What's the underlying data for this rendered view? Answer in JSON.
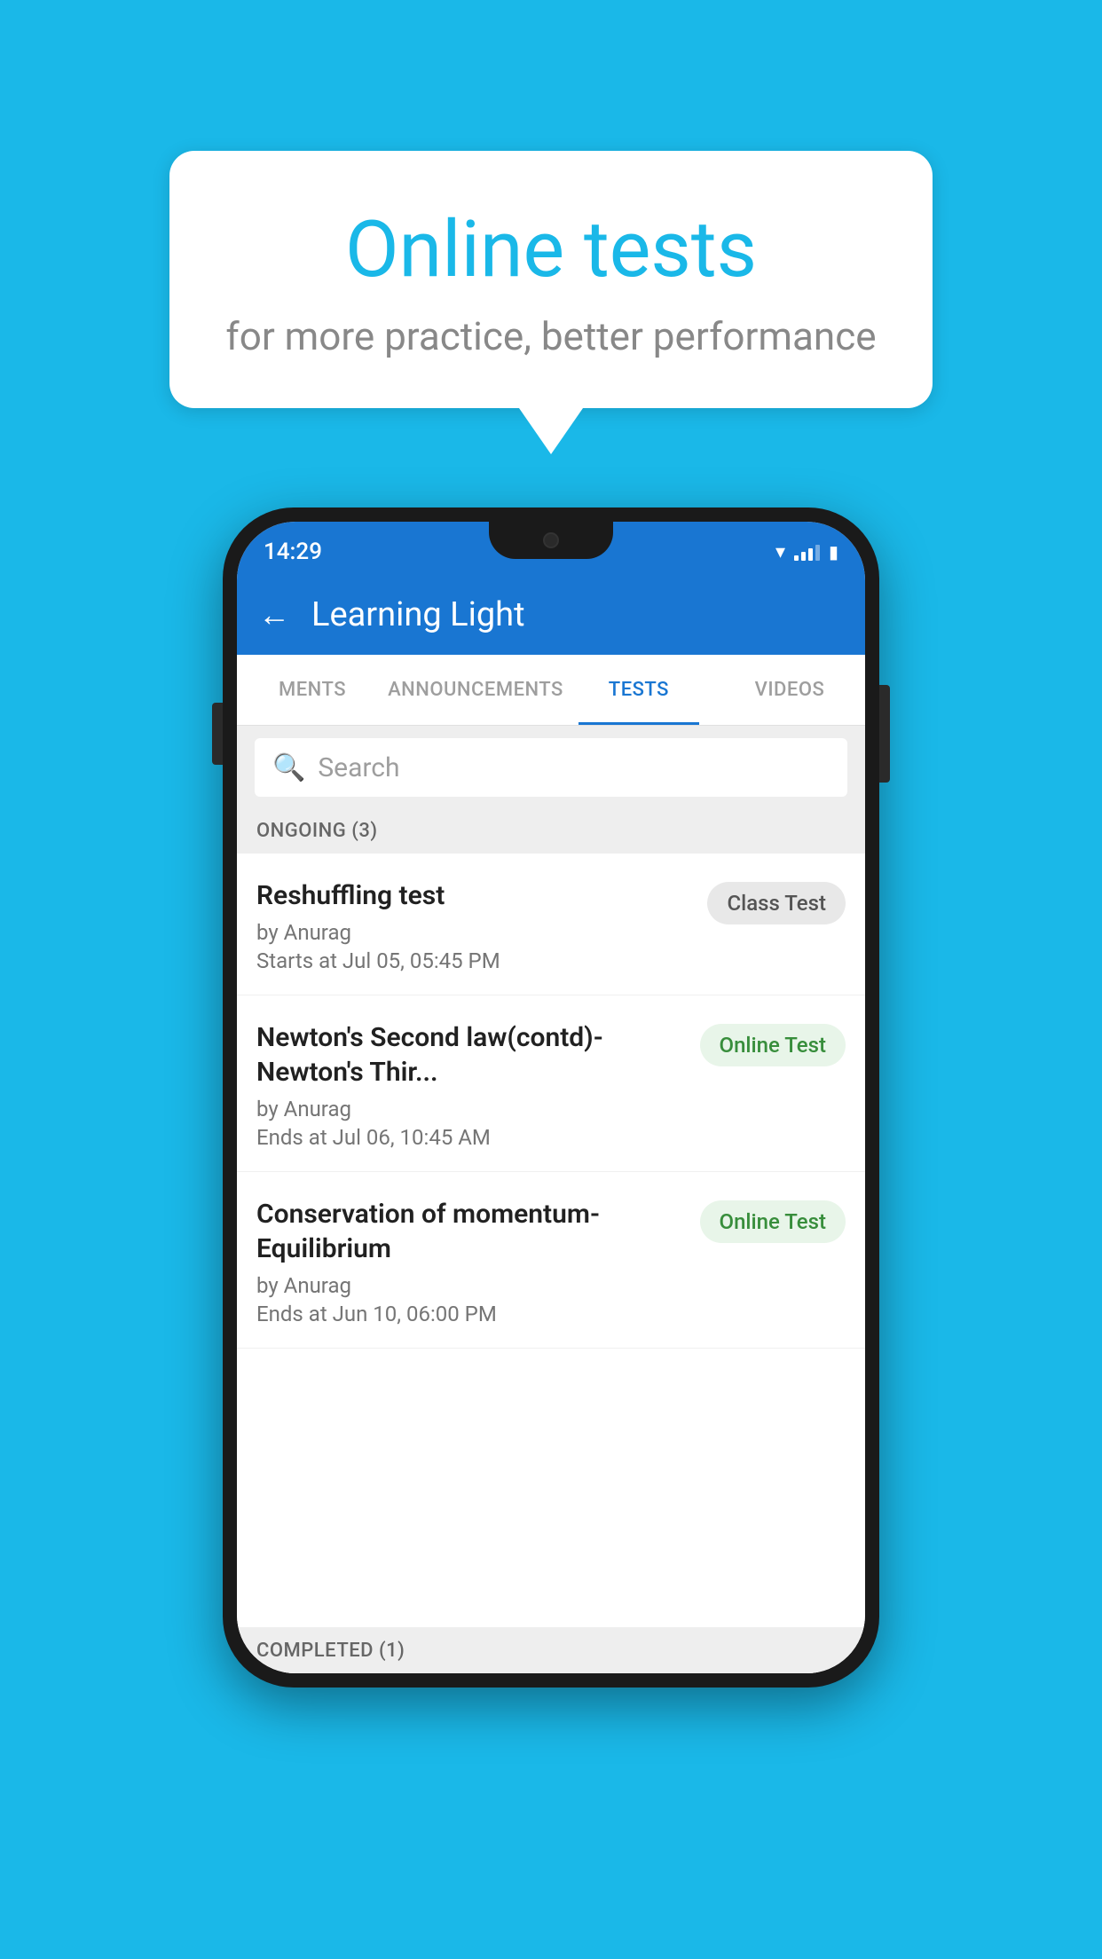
{
  "background_color": "#1ab8e8",
  "speech_bubble": {
    "title": "Online tests",
    "subtitle": "for more practice, better performance"
  },
  "phone": {
    "status_bar": {
      "time": "14:29"
    },
    "header": {
      "title": "Learning Light",
      "back_label": "←"
    },
    "tabs": [
      {
        "label": "MENTS",
        "active": false
      },
      {
        "label": "ANNOUNCEMENTS",
        "active": false
      },
      {
        "label": "TESTS",
        "active": true
      },
      {
        "label": "VIDEOS",
        "active": false
      }
    ],
    "search": {
      "placeholder": "Search"
    },
    "ongoing_section": {
      "label": "ONGOING (3)"
    },
    "tests": [
      {
        "name": "Reshuffling test",
        "author": "by Anurag",
        "date": "Starts at  Jul 05, 05:45 PM",
        "badge": "Class Test",
        "badge_type": "class"
      },
      {
        "name": "Newton's Second law(contd)-Newton's Thir...",
        "author": "by Anurag",
        "date": "Ends at  Jul 06, 10:45 AM",
        "badge": "Online Test",
        "badge_type": "online"
      },
      {
        "name": "Conservation of momentum-Equilibrium",
        "author": "by Anurag",
        "date": "Ends at  Jun 10, 06:00 PM",
        "badge": "Online Test",
        "badge_type": "online"
      }
    ],
    "completed_section": {
      "label": "COMPLETED (1)"
    }
  }
}
